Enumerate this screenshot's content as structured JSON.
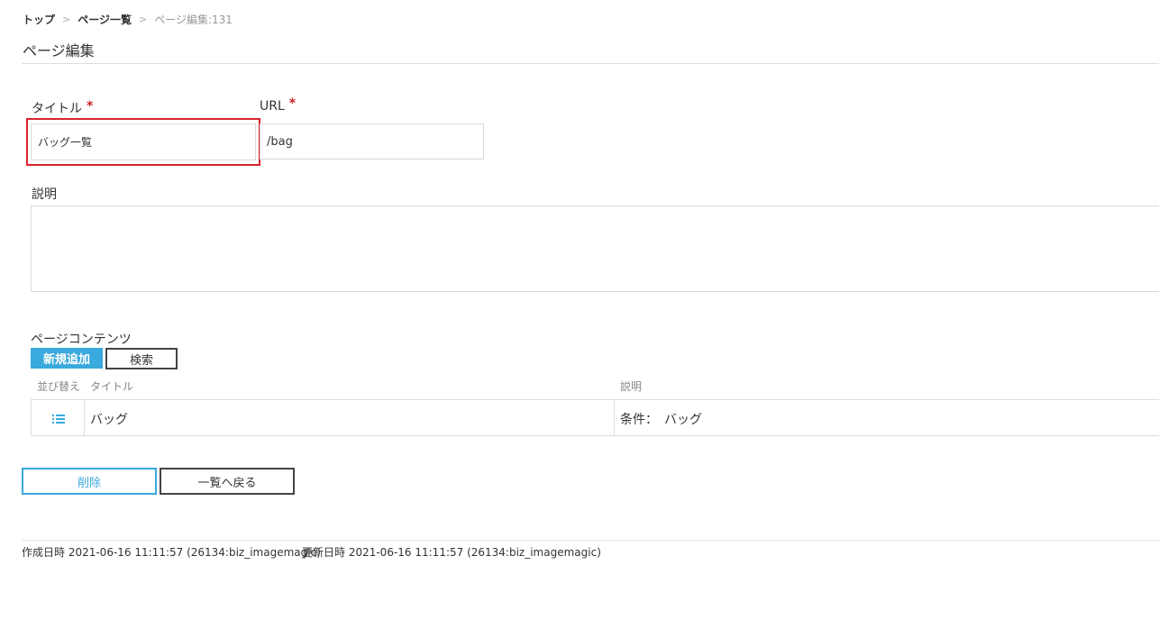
{
  "breadcrumb": {
    "top": "トップ",
    "list": "ページ一覧",
    "current": "ページ編集:131",
    "separator": ">"
  },
  "page": {
    "title": "ページ編集"
  },
  "form": {
    "title_label": "タイトル",
    "title_value": "バッグ一覧",
    "url_label": "URL",
    "url_value": "/bag",
    "required_mark": "*",
    "description_label": "説明",
    "description_value": ""
  },
  "contents": {
    "section_label": "ページコンテンツ",
    "add_button": "新規追加",
    "search_button": "検索",
    "columns": {
      "sort": "並び替え",
      "title": "タイトル",
      "description": "説明"
    },
    "rows": [
      {
        "title": "バッグ",
        "description": "条件：　バッグ"
      }
    ]
  },
  "actions": {
    "delete_button": "削除",
    "back_button": "一覧へ戻る"
  },
  "footer": {
    "created": "作成日時 2021-06-16 11:11:57 (26134:biz_imagemagic)",
    "updated": "更新日時 2021-06-16 11:11:57 (26134:biz_imagemagic)"
  },
  "colors": {
    "accent": "#3aa9dd",
    "highlight": "#d9232e",
    "required": "#cc2222"
  },
  "icons": {
    "sort_handle": "list-icon"
  }
}
